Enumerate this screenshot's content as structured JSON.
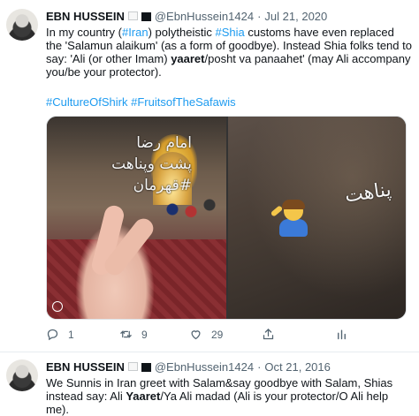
{
  "tweets": [
    {
      "author_name": "EBN HUSSEIN",
      "handle": "@EbnHussein1424",
      "separator": "·",
      "date": "Jul 21, 2020",
      "text": {
        "p1": "In my country (",
        "h1": "#Iran",
        "p2": ") polytheistic ",
        "h2": "#Shia",
        "p3": " customs have even replaced the 'Salamun alaikum' (as a form of goodbye). Instead Shia folks tend to say: 'Ali (or other Imam) ",
        "b1": "yaaret",
        "p4": "/posht va panaahet' (may Ali accompany you/be your protector)."
      },
      "hashtags": [
        "#CultureOfShirk",
        "#FruitsofTheSafawis"
      ],
      "media": {
        "left_overlay": [
          "امام رضا",
          "پشت وپناهت",
          "#قهرمان"
        ],
        "right_overlay": "پناهت"
      },
      "actions": {
        "reply_count": "1",
        "retweet_count": "9",
        "like_count": "29",
        "share_label": "",
        "analytics_label": ""
      }
    },
    {
      "author_name": "EBN HUSSEIN",
      "handle": "@EbnHussein1424",
      "separator": "·",
      "date": "Oct 21, 2016",
      "text": {
        "p1": "We Sunnis in Iran greet with Salam&say goodbye with Salam, Shias instead say: Ali ",
        "b1": "Yaaret",
        "p2": "/Ya Ali madad (Ali is your protector/O Ali help me)."
      }
    }
  ],
  "icons": {
    "reply": "reply-icon",
    "retweet": "retweet-icon",
    "like": "heart-icon",
    "share": "share-icon",
    "analytics": "analytics-icon"
  },
  "colors": {
    "link": "#1d9bf0",
    "text": "#0f1419",
    "muted": "#536471"
  }
}
